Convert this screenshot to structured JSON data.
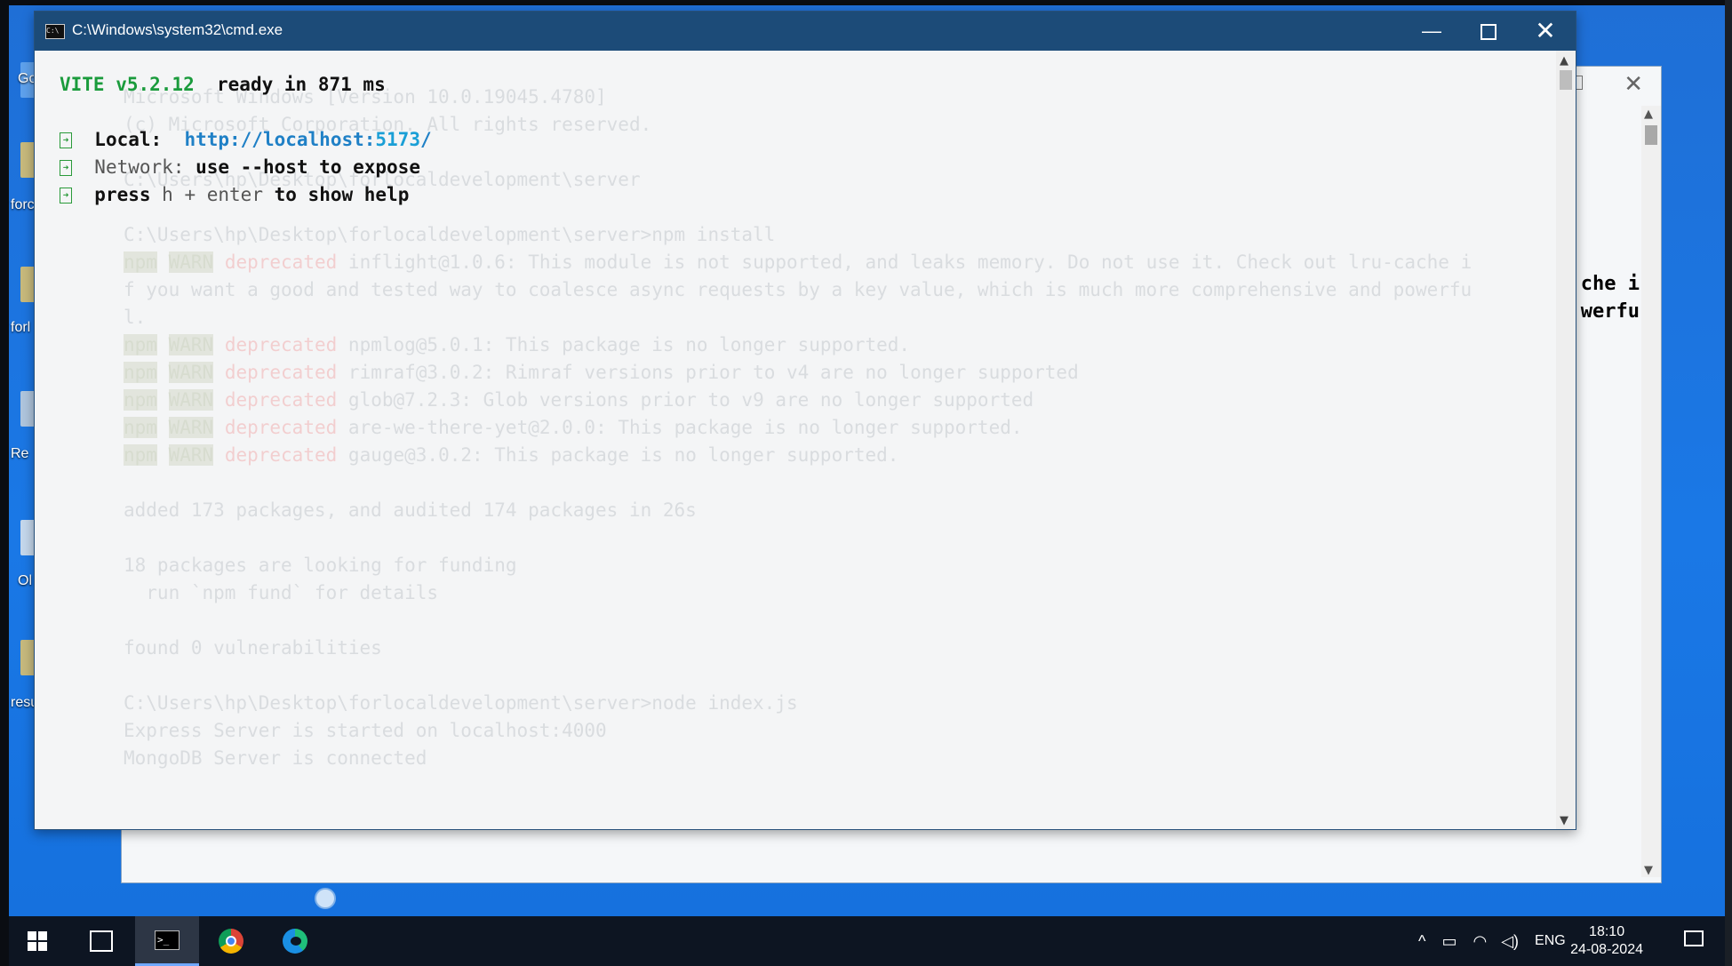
{
  "window": {
    "title": "C:\\Windows\\system32\\cmd.exe",
    "minimize": "—",
    "close": "✕"
  },
  "console": {
    "vite_name": "VITE v5.2.12",
    "ready_text": "ready in",
    "ready_ms": "871",
    "ms_unit": "ms",
    "arrow_glyph": "➜",
    "local_label": "Local:",
    "local_url_base": "http://localhost:",
    "local_port": "5173",
    "local_slash": "/",
    "network_label": "Network:",
    "network_text": "use --host to expose",
    "help_pre": "press",
    "help_key": "h + enter",
    "help_post": "to show help"
  },
  "ghost": {
    "l1": "Microsoft Windows [Version 10.0.19045.4780]",
    "l2": "(c) Microsoft Corporation. All rights reserved.",
    "l3": "C:\\Users\\hp\\Desktop\\forlocaldevelopment\\server",
    "l4": "C:\\Users\\hp\\Desktop\\forlocaldevelopment\\server>npm install",
    "npm": "npm",
    "warn": "WARN",
    "dep": "deprecated",
    "w1": "inflight@1.0.6: This module is not supported, and leaks memory. Do not use it. Check out lru-cache i",
    "w1b": "f you want a good and tested way to coalesce async requests by a key value, which is much more comprehensive and powerfu",
    "w1c": "l.",
    "w2": "npmlog@5.0.1: This package is no longer supported.",
    "w3": "rimraf@3.0.2: Rimraf versions prior to v4 are no longer supported",
    "w4": "glob@7.2.3: Glob versions prior to v9 are no longer supported",
    "w5": "are-we-there-yet@2.0.0: This package is no longer supported.",
    "w6": "gauge@3.0.2: This package is no longer supported.",
    "added": "added 173 packages, and audited 174 packages in 26s",
    "fund1": "18 packages are looking for funding",
    "fund2": "  run `npm fund` for details",
    "vuln": "found 0 vulnerabilities",
    "node": "C:\\Users\\hp\\Desktop\\forlocaldevelopment\\server>node index.js",
    "express": "Express Server is started on localhost:4000",
    "mongo": "MongoDB Server is connected"
  },
  "background_window": {
    "overflow_line1": "che i",
    "overflow_line2": "werfu"
  },
  "desktop": {
    "icon1": "Go",
    "icon2": "forc",
    "icon3": "forl",
    "icon4": "Re",
    "icon5": "Ol",
    "icon6": "resu"
  },
  "taskbar": {
    "tray_up": "^",
    "lang": "ENG",
    "time": "18:10",
    "date": "24-08-2024"
  }
}
